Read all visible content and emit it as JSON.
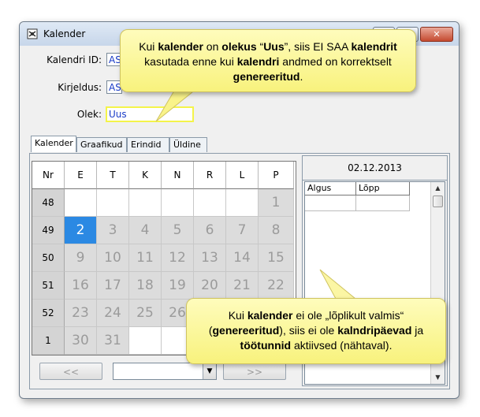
{
  "window": {
    "title": "Kalender",
    "minimize": "–",
    "maximize": "□",
    "close": "✕"
  },
  "form": {
    "id_label": "Kalendri ID:",
    "id_value": "AS",
    "desc_label": "Kirjeldus:",
    "desc_value": "AS",
    "state_label": "Olek:",
    "state_value": "Uus"
  },
  "tabs": [
    "Kalender",
    "Graafikud",
    "Erindid",
    "Üldine"
  ],
  "calendar": {
    "headers": [
      "Nr",
      "E",
      "T",
      "K",
      "N",
      "R",
      "L",
      "P"
    ],
    "weeks": [
      {
        "nr": "48",
        "days": [
          "",
          "",
          "",
          "",
          "",
          "",
          "1"
        ]
      },
      {
        "nr": "49",
        "days": [
          "2",
          "3",
          "4",
          "5",
          "6",
          "7",
          "8"
        ]
      },
      {
        "nr": "50",
        "days": [
          "9",
          "10",
          "11",
          "12",
          "13",
          "14",
          "15"
        ]
      },
      {
        "nr": "51",
        "days": [
          "16",
          "17",
          "18",
          "19",
          "20",
          "21",
          "22"
        ]
      },
      {
        "nr": "52",
        "days": [
          "23",
          "24",
          "25",
          "26",
          "",
          "",
          ""
        ]
      },
      {
        "nr": "1",
        "days": [
          "30",
          "31",
          "",
          "",
          "",
          "",
          ""
        ]
      }
    ],
    "selected_day": "2",
    "prev_label": "<<",
    "next_label": ">>"
  },
  "side": {
    "date": "02.12.2013",
    "col_start": "Algus",
    "col_end": "Lõpp"
  },
  "callout_top": "Kui <b>kalender</b> on <b>olekus</b> “<b>Uus</b>”, siis EI SAA <b>kalendrit</b> kasutada enne kui <b>kalendri</b> andmed on korrektselt <b>genereeritud</b>.",
  "callout_bottom": "Kui <b>kalender</b> ei ole „lõplikult valmis“ (<b>genereeritud</b>), siis ei ole <b>kalndripäevad</b> ja <b>töötunnid</b> aktiivsed (nähtaval)."
}
